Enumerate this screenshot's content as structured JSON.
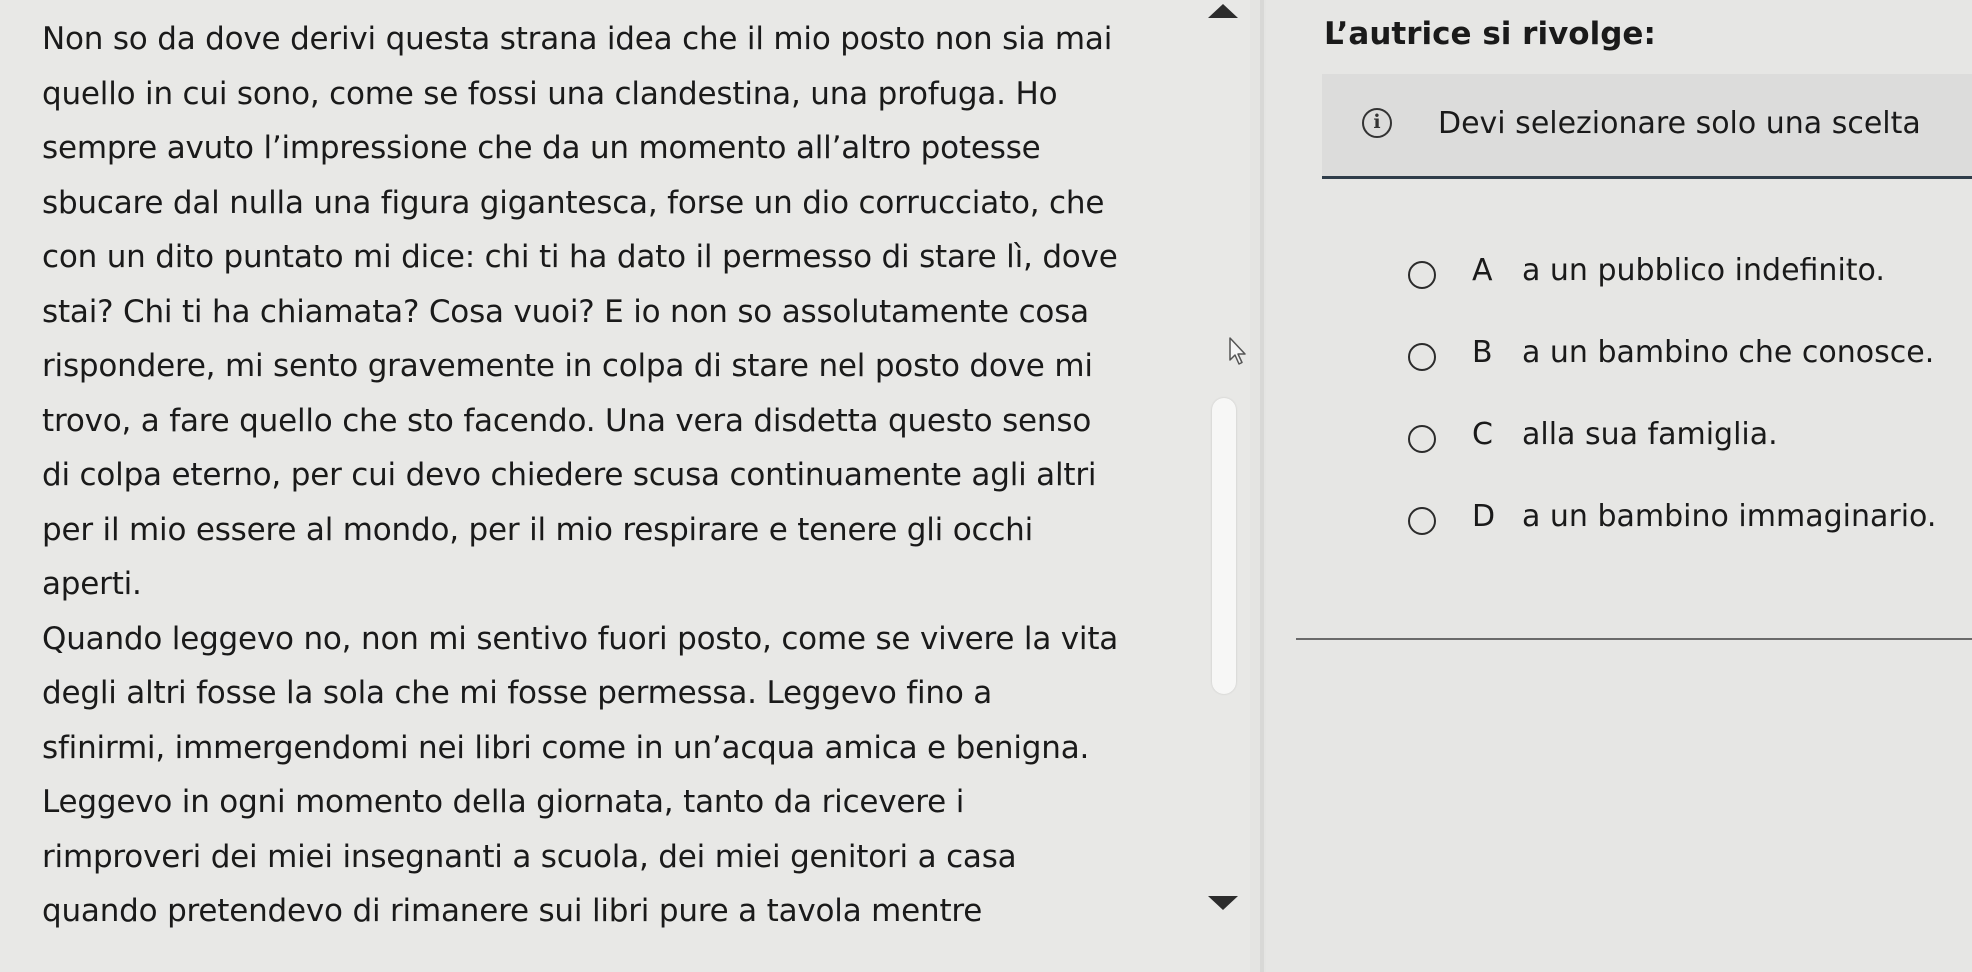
{
  "reading": {
    "lines": [
      "Non so da dove derivi questa strana idea che il mio posto non sia mai",
      "quello in cui sono, come se fossi una clandestina, una profuga. Ho",
      "sempre avuto l’impressione che da un momento all’altro potesse",
      "sbucare dal nulla una figura gigantesca, forse un dio corrucciato, che",
      "con un dito puntato mi dice: chi ti ha dato il permesso di stare lì, dove",
      "stai? Chi ti ha chiamata? Cosa vuoi? E io non so assolutamente cosa",
      "rispondere, mi sento gravemente in colpa di stare nel posto dove mi",
      "trovo, a fare quello che sto facendo. Una vera disdetta questo senso",
      "di colpa eterno, per cui devo chiedere scusa continuamente agli altri",
      "per il mio essere al mondo, per il mio respirare e tenere gli occhi",
      "aperti.",
      "Quando leggevo no, non mi sentivo fuori posto, come se vivere la vita",
      "degli altri fosse la sola che mi fosse permessa. Leggevo fino a",
      "sfinirmi, immergendomi nei libri come in un’acqua amica e benigna.",
      "Leggevo in ogni momento della giornata, tanto da ricevere i",
      "rimproveri dei miei insegnanti a scuola, dei miei genitori a casa",
      "quando pretendevo di rimanere sui libri pure a tavola mentre"
    ]
  },
  "question": {
    "title": "L’autrice si rivolge:",
    "info_icon": "info-icon",
    "info_text": "Devi selezionare solo una scelta",
    "options": [
      {
        "letter": "A",
        "text": "a un pubblico indefinito."
      },
      {
        "letter": "B",
        "text": "a un bambino che conosce."
      },
      {
        "letter": "C",
        "text": "alla sua famiglia."
      },
      {
        "letter": "D",
        "text": "a un bambino immaginario."
      }
    ]
  },
  "colors": {
    "background": "#e4e4e2",
    "text": "#1a1a1a",
    "info_border": "#2f3d4a"
  }
}
